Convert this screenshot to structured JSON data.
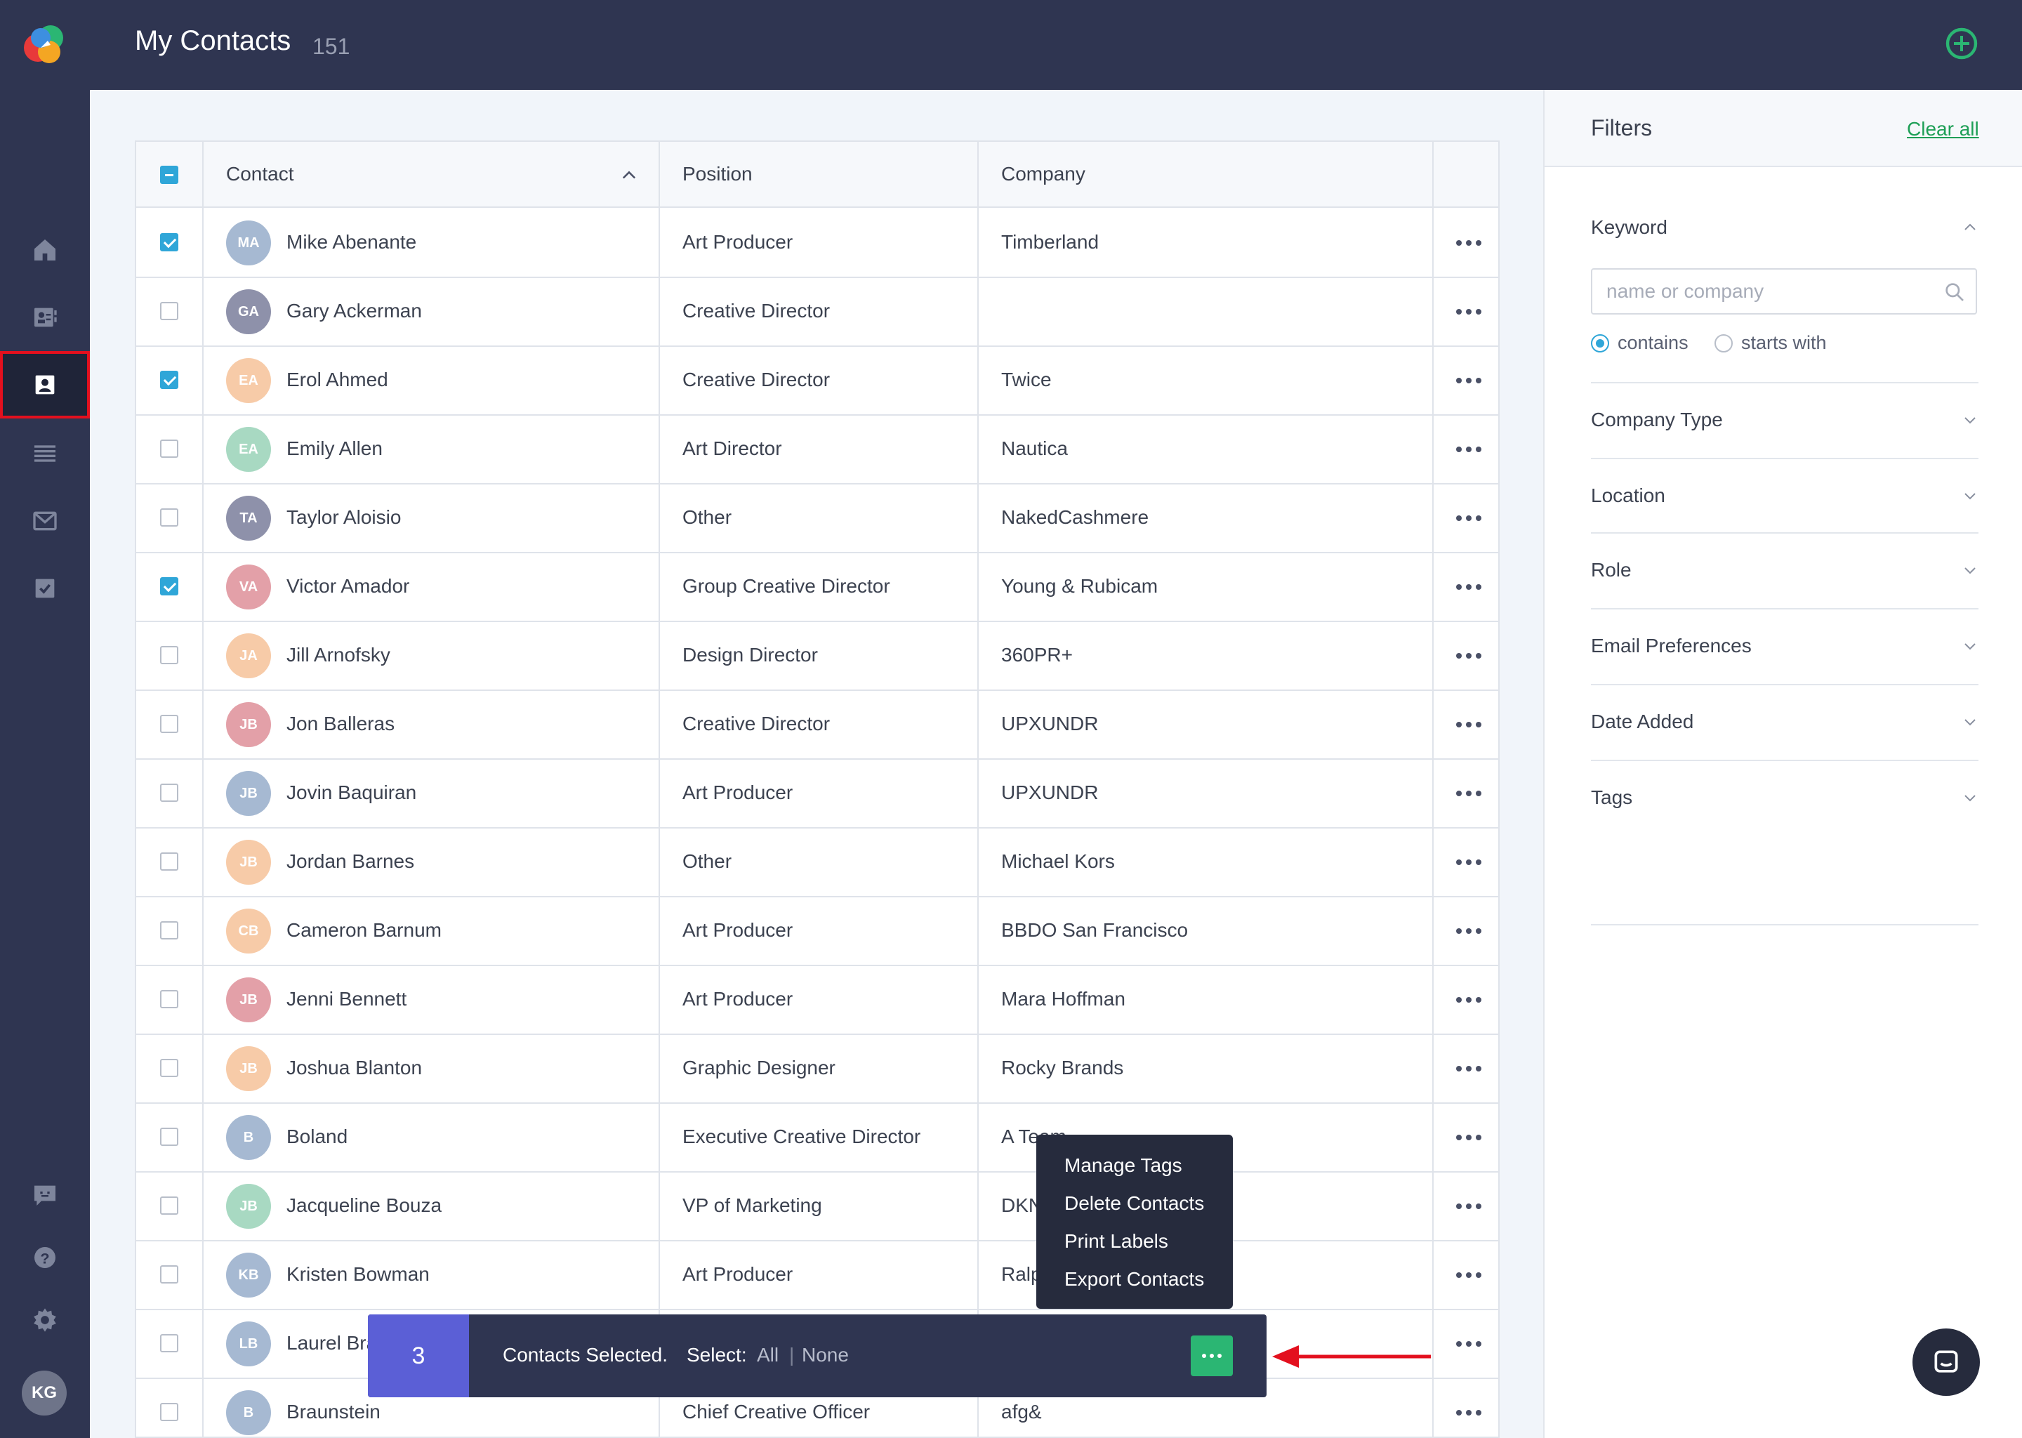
{
  "header": {
    "title": "My Contacts",
    "count": "151"
  },
  "table": {
    "headers": {
      "contact": "Contact",
      "position": "Position",
      "company": "Company"
    },
    "rows": [
      {
        "initials": "MA",
        "name": "Mike Abenante",
        "position": "Art Producer",
        "company": "Timberland",
        "checked": true,
        "color": "#a6b9d2"
      },
      {
        "initials": "GA",
        "name": "Gary Ackerman",
        "position": "Creative Director",
        "company": "",
        "checked": false,
        "color": "#8e91aa"
      },
      {
        "initials": "EA",
        "name": "Erol Ahmed",
        "position": "Creative Director",
        "company": "Twice",
        "checked": true,
        "color": "#f7cba8"
      },
      {
        "initials": "EA",
        "name": "Emily Allen",
        "position": "Art Director",
        "company": "Nautica",
        "checked": false,
        "color": "#a8d9c2"
      },
      {
        "initials": "TA",
        "name": "Taylor Aloisio",
        "position": "Other",
        "company": "NakedCashmere",
        "checked": false,
        "color": "#8e91aa"
      },
      {
        "initials": "VA",
        "name": "Victor Amador",
        "position": "Group Creative Director",
        "company": "Young & Rubicam",
        "checked": true,
        "color": "#e3a0a8"
      },
      {
        "initials": "JA",
        "name": "Jill Arnofsky",
        "position": "Design Director",
        "company": "360PR+",
        "checked": false,
        "color": "#f7cba8"
      },
      {
        "initials": "JB",
        "name": "Jon Balleras",
        "position": "Creative Director",
        "company": "UPXUNDR",
        "checked": false,
        "color": "#e3a0a8"
      },
      {
        "initials": "JB",
        "name": "Jovin Baquiran",
        "position": "Art Producer",
        "company": "UPXUNDR",
        "checked": false,
        "color": "#a6b9d2"
      },
      {
        "initials": "JB",
        "name": "Jordan Barnes",
        "position": "Other",
        "company": "Michael Kors",
        "checked": false,
        "color": "#f7cba8"
      },
      {
        "initials": "CB",
        "name": "Cameron Barnum",
        "position": "Art Producer",
        "company": "BBDO San Francisco",
        "checked": false,
        "color": "#f7cba8"
      },
      {
        "initials": "JB",
        "name": "Jenni Bennett",
        "position": "Art Producer",
        "company": "Mara Hoffman",
        "checked": false,
        "color": "#e3a0a8"
      },
      {
        "initials": "JB",
        "name": "Joshua Blanton",
        "position": "Graphic Designer",
        "company": "Rocky Brands",
        "checked": false,
        "color": "#f7cba8"
      },
      {
        "initials": "B",
        "name": "Boland",
        "position": "Executive Creative Director",
        "company": "A Team",
        "checked": false,
        "color": "#a6b9d2"
      },
      {
        "initials": "JB",
        "name": "Jacqueline Bouza",
        "position": "VP of Marketing",
        "company": "DKNY",
        "checked": false,
        "color": "#a8d9c2"
      },
      {
        "initials": "KB",
        "name": "Kristen Bowman",
        "position": "Art Producer",
        "company": "Ralph Lauren",
        "checked": false,
        "color": "#a6b9d2"
      },
      {
        "initials": "LB",
        "name": "Laurel Bradley",
        "position": "",
        "company": "",
        "checked": false,
        "color": "#a6b9d2"
      },
      {
        "initials": "B",
        "name": "Braunstein",
        "position": "Chief Creative Officer",
        "company": "afg&",
        "checked": false,
        "color": "#a6b9d2"
      }
    ]
  },
  "filters": {
    "title": "Filters",
    "clear_all": "Clear all",
    "keyword": {
      "label": "Keyword",
      "placeholder": "name or company",
      "opt_contains": "contains",
      "opt_starts": "starts with"
    },
    "sections": [
      "Company Type",
      "Location",
      "Role",
      "Email Preferences",
      "Date Added",
      "Tags"
    ]
  },
  "menu": {
    "items": [
      "Manage Tags",
      "Delete Contacts",
      "Print Labels",
      "Export Contacts"
    ]
  },
  "selection_bar": {
    "count": "3",
    "text": "Contacts Selected.",
    "select_label": "Select:",
    "all": "All",
    "separator": "|",
    "none": "None"
  },
  "user": {
    "initials": "KG"
  },
  "colors": {
    "sidebar": "#2f3551",
    "accent_green": "#2bb673",
    "checkbox_blue": "#2fa6d8",
    "selection_count": "#5b5fd6",
    "annotation_red": "#e3101e"
  },
  "icons": [
    "app-logo",
    "home-icon",
    "contacts-book-icon",
    "contact-card-icon",
    "list-icon",
    "mail-icon",
    "tasks-icon",
    "feedback-icon",
    "help-icon",
    "settings-icon",
    "add-circle-icon",
    "search-icon",
    "chat-icon"
  ]
}
